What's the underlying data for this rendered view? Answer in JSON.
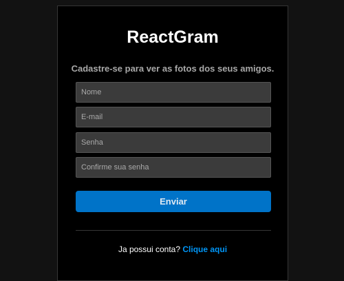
{
  "app": {
    "title": "ReactGram",
    "subtitle": "Cadastre-se para ver as fotos dos seus amigos."
  },
  "form": {
    "name_placeholder": "Nome",
    "email_placeholder": "E-mail",
    "password_placeholder": "Senha",
    "confirm_placeholder": "Confirme sua senha",
    "submit_label": "Enviar"
  },
  "footer": {
    "prompt": "Ja possui conta?",
    "link_label": "Clique aqui"
  },
  "colors": {
    "page_background": "#121212",
    "card_background": "#000000",
    "input_background": "#3b3b3b",
    "accent": "#0073c8",
    "link": "#0095f6"
  }
}
